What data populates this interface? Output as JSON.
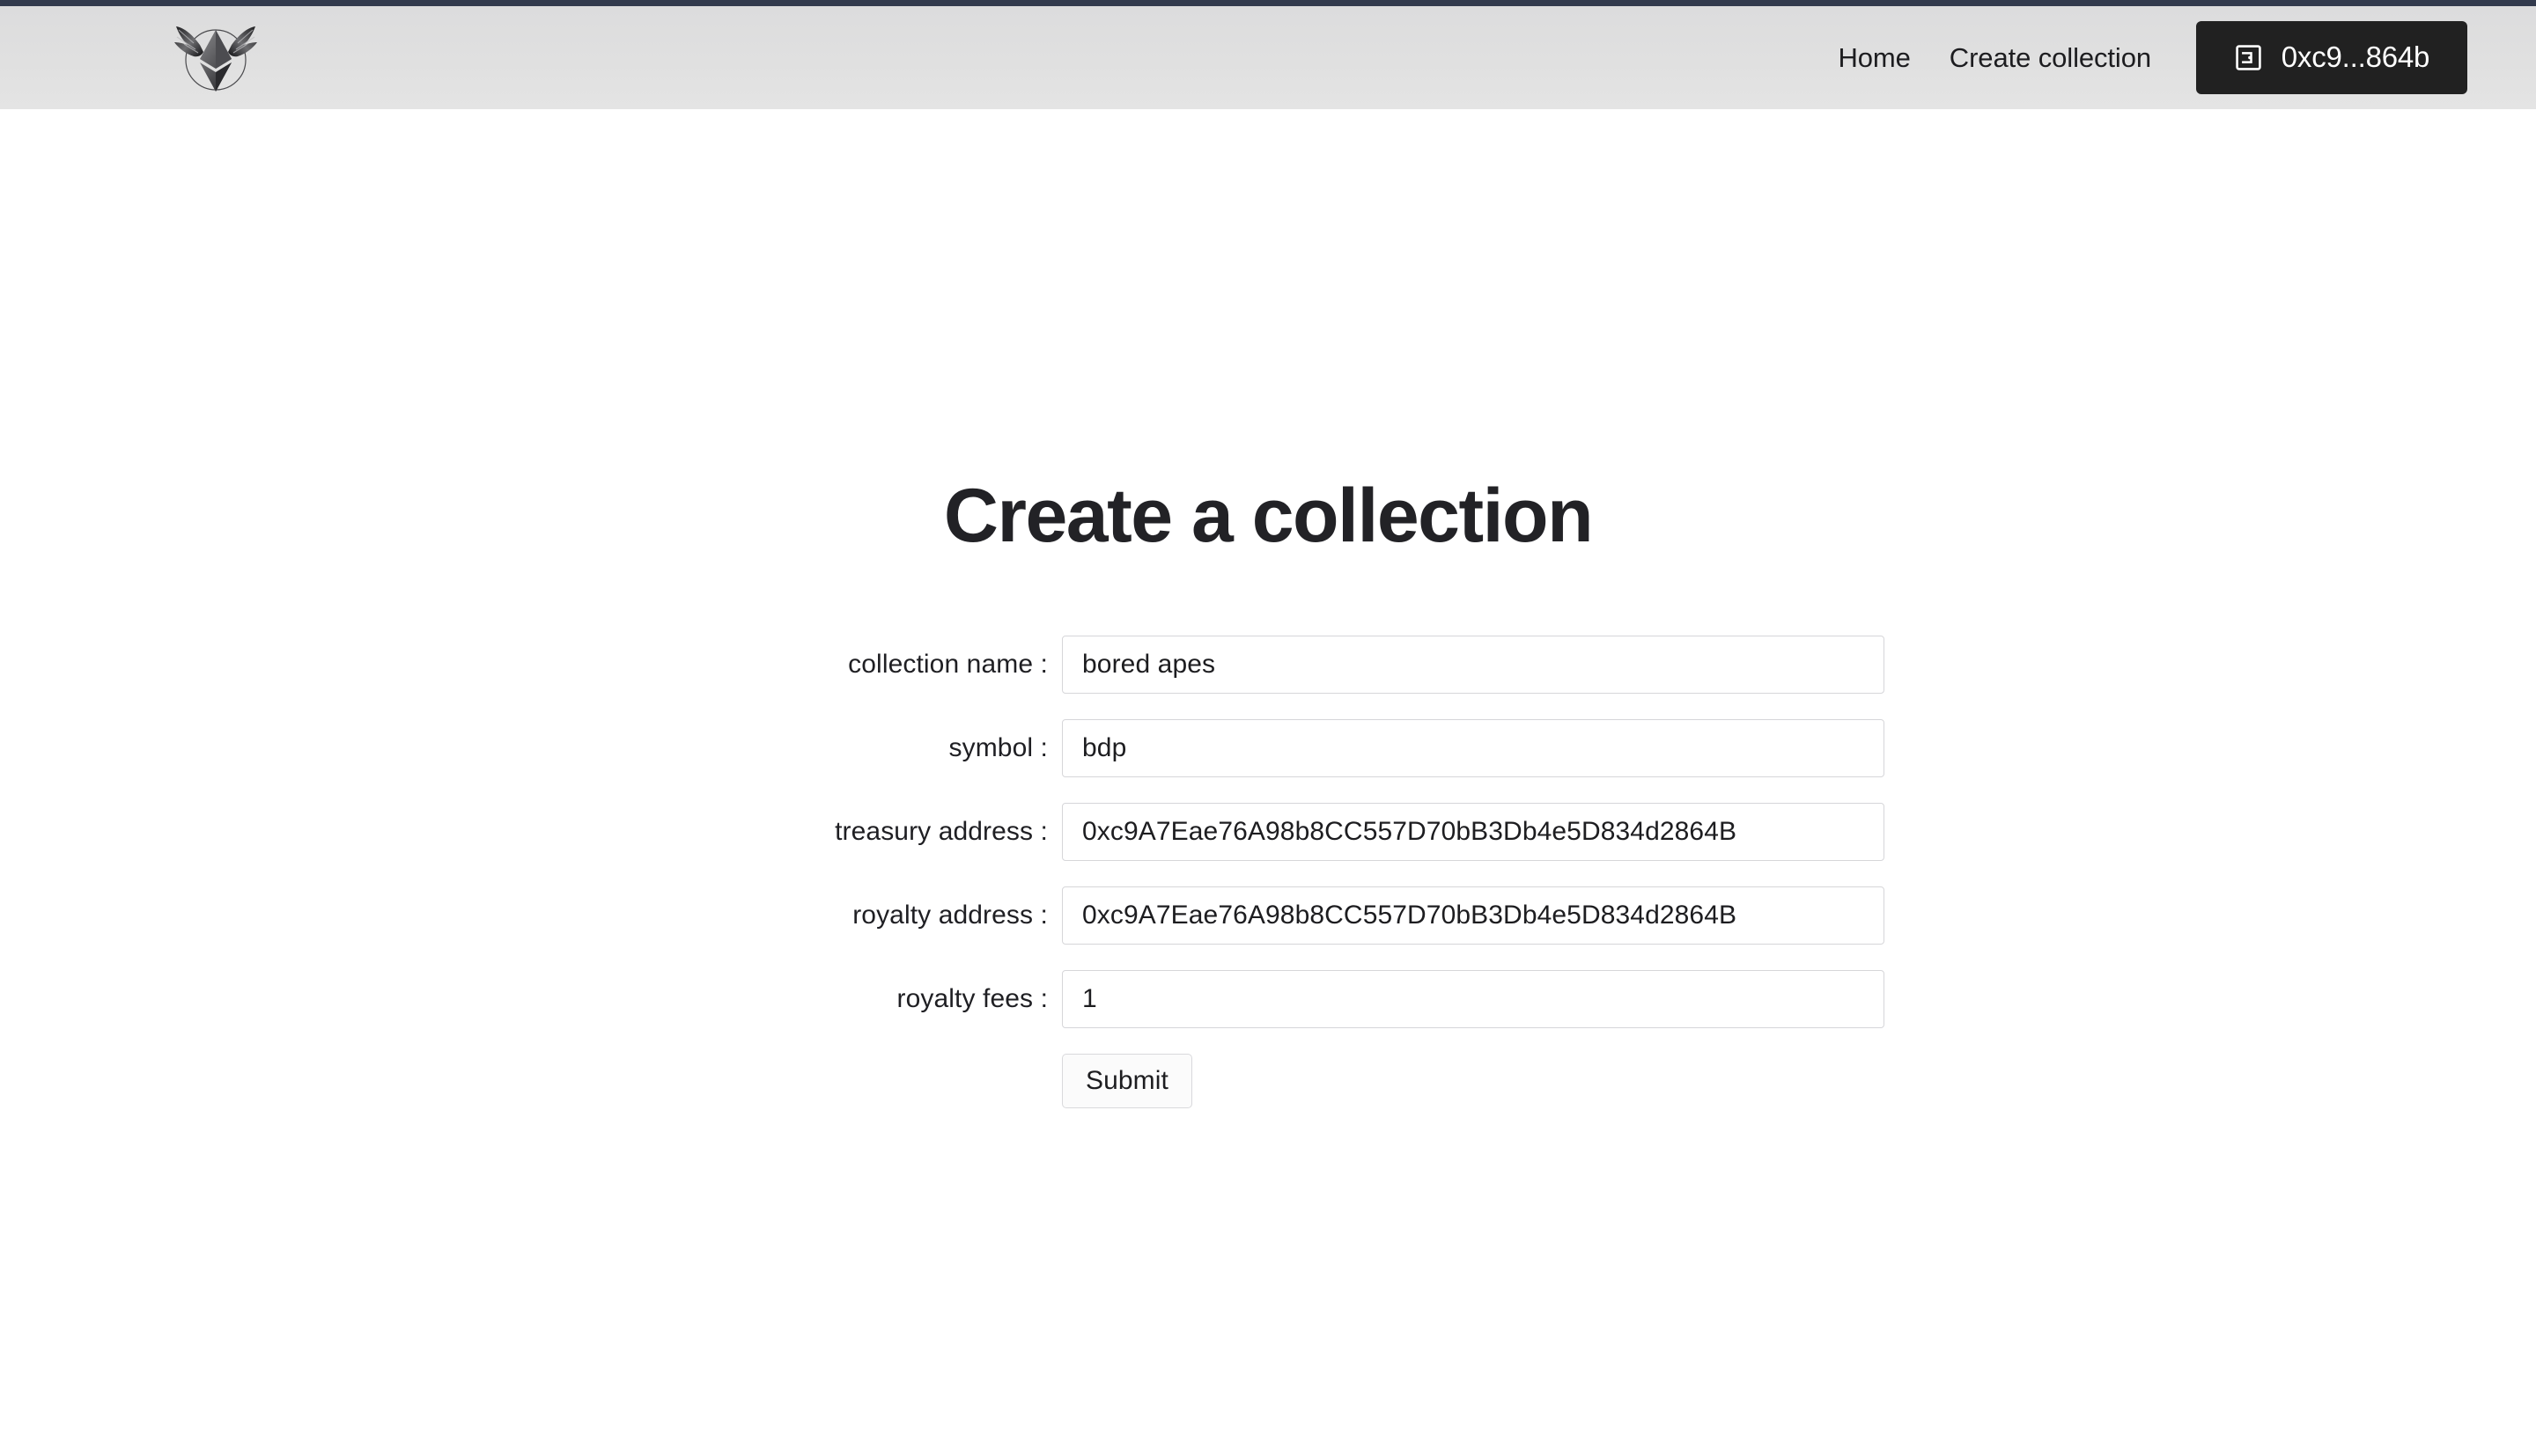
{
  "header": {
    "logo_icon": "winged-ethereum-logo",
    "nav": [
      {
        "label": "Home",
        "name": "nav-link-home"
      },
      {
        "label": "Create collection",
        "name": "nav-link-create-collection"
      }
    ],
    "wallet": {
      "icon": "wallet-icon",
      "address_short": "0xc9...864b"
    }
  },
  "main": {
    "title": "Create a collection",
    "form": {
      "fields": [
        {
          "label": "collection name :",
          "value": "bored apes",
          "placeholder": "",
          "name": "collection-name"
        },
        {
          "label": "symbol :",
          "value": "bdp",
          "placeholder": "",
          "name": "symbol"
        },
        {
          "label": "treasury address :",
          "value": "0xc9A7Eae76A98b8CC557D70bB3Db4e5D834d2864B",
          "placeholder": "",
          "name": "treasury-address"
        },
        {
          "label": "royalty address :",
          "value": "0xc9A7Eae76A98b8CC557D70bB3Db4e5D834d2864B",
          "placeholder": "",
          "name": "royalty-address"
        },
        {
          "label": "royalty fees :",
          "value": "1",
          "placeholder": "",
          "name": "royalty-fees"
        }
      ],
      "submit_label": "Submit"
    }
  },
  "colors": {
    "top_strip": "#323a4d",
    "header_bg": "#e0e0e0",
    "wallet_button_bg": "#212121",
    "text_dark": "#1d1d20",
    "title": "#222226",
    "input_border": "#d6d6d9",
    "page_bg": "#ffffff"
  }
}
